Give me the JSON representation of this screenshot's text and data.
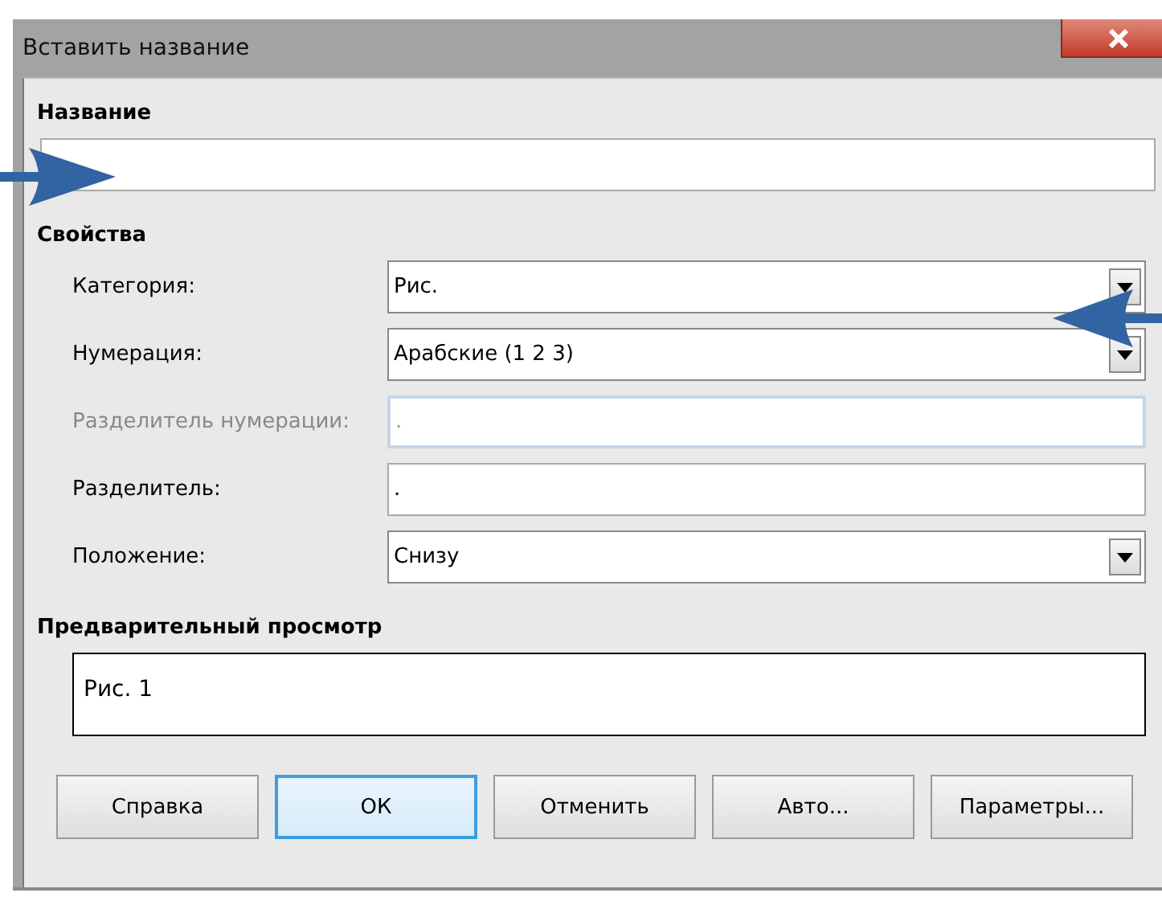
{
  "window": {
    "title": "Вставить название"
  },
  "caption": {
    "label": "Название"
  },
  "properties": {
    "label": "Свойства",
    "rows": [
      {
        "label": "Категория:",
        "kind": "combo",
        "value": "Рис.",
        "disabled": false
      },
      {
        "label": "Нумерация:",
        "kind": "combo",
        "value": "Арабские (1 2 3)",
        "disabled": false
      },
      {
        "label": "Разделитель нумерации:",
        "kind": "text",
        "value": ".",
        "disabled": true
      },
      {
        "label": "Разделитель:",
        "kind": "text",
        "value": ".",
        "disabled": false
      },
      {
        "label": "Положение:",
        "kind": "combo",
        "value": "Снизу",
        "disabled": false
      }
    ]
  },
  "preview": {
    "label": "Предварительный просмотр",
    "text": "Рис. 1"
  },
  "buttons": [
    {
      "label": "Справка",
      "selected": false
    },
    {
      "label": "ОК",
      "selected": true
    },
    {
      "label": "Отменить",
      "selected": false
    },
    {
      "label": "Авто...",
      "selected": false
    },
    {
      "label": "Параметры...",
      "selected": false
    }
  ],
  "annotations": [
    {
      "kind": "arrow"
    },
    {
      "kind": "arrow"
    }
  ]
}
